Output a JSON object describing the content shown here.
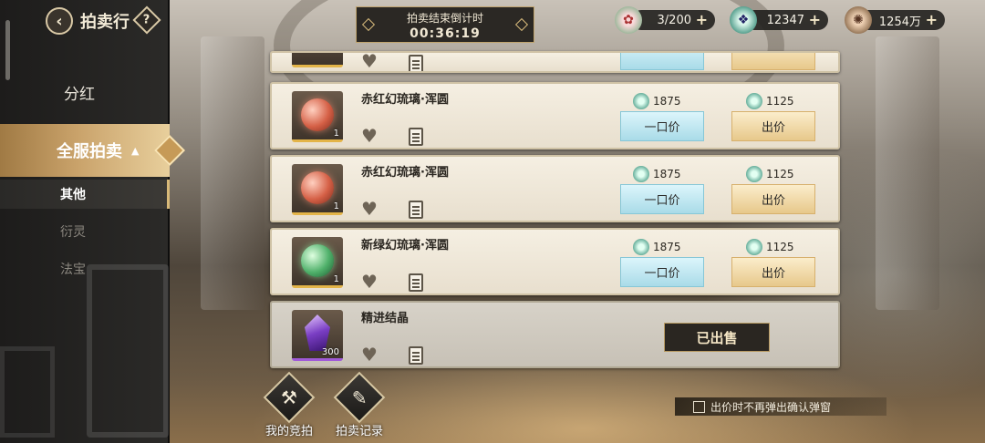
{
  "header": {
    "back_icon": "back-arrow-icon",
    "title": "拍卖行",
    "help_label": "?"
  },
  "countdown": {
    "label": "拍卖结束倒计时",
    "time": "00:36:19"
  },
  "resources": [
    {
      "icon": "stamina-icon",
      "value": "3/200"
    },
    {
      "icon": "jade-icon",
      "value": "12347"
    },
    {
      "icon": "copper-coin-icon",
      "value": "1254万"
    }
  ],
  "sidebar": {
    "items": [
      {
        "label": "分红"
      },
      {
        "label": "全服拍卖"
      },
      {
        "label": "其他"
      },
      {
        "label": "衍灵"
      },
      {
        "label": "法宝"
      }
    ],
    "expanded_caret": "▲"
  },
  "listings": [
    {
      "name": "赤红幻琉璃·浑圆",
      "qty": "1",
      "buyout_price": "1875",
      "bid_price": "1125",
      "buyout_label": "一口价",
      "bid_label": "出价"
    },
    {
      "name": "赤红幻琉璃·浑圆",
      "qty": "1",
      "buyout_price": "1875",
      "bid_price": "1125",
      "buyout_label": "一口价",
      "bid_label": "出价"
    },
    {
      "name": "新绿幻琉璃·浑圆",
      "qty": "1",
      "buyout_price": "1875",
      "bid_price": "1125",
      "buyout_label": "一口价",
      "bid_label": "出价"
    },
    {
      "name": "精进结晶",
      "qty": "300",
      "sold_label": "已出售"
    }
  ],
  "bottom": {
    "my_bids_label": "我的竞拍",
    "records_label": "拍卖记录",
    "confirm_checkbox_label": "出价时不再弹出确认弹窗"
  },
  "colors": {
    "accent_gold": "#c9a26a",
    "buyout_blue": "#a9dbe8",
    "bid_gold": "#e7c88b",
    "sidebar_bg": "#2b2a28"
  }
}
